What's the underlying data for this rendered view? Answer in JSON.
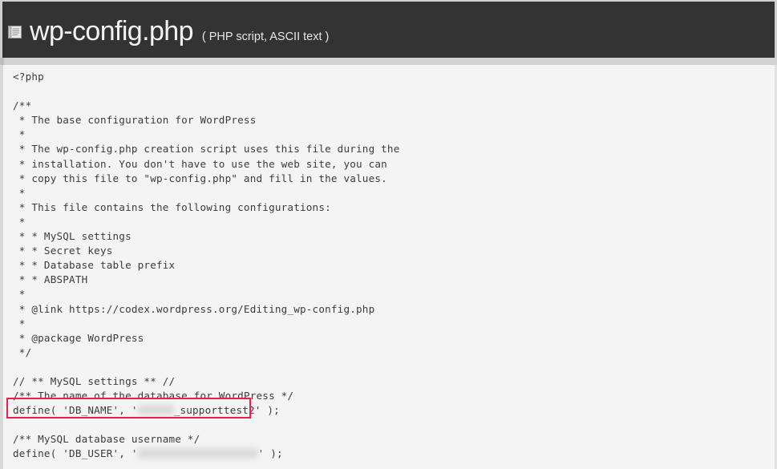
{
  "header": {
    "icon": "file-document-icon",
    "title": "wp-config.php",
    "meta": "( PHP script, ASCII text )"
  },
  "colors": {
    "header_bg": "#333333",
    "code_bg": "#f4f4f4",
    "code_text": "#3b3b3b",
    "highlight_border": "#e8204f",
    "title_text": "#f2f2f2"
  },
  "annotation": {
    "name": "db-name-highlight",
    "target_line": "define( 'DB_NAME', '[redacted]_supporttest2' );"
  },
  "code": {
    "language": "php",
    "lines": [
      "<?php",
      "",
      "/**",
      " * The base configuration for WordPress",
      " *",
      " * The wp-config.php creation script uses this file during the",
      " * installation. You don't have to use the web site, you can",
      " * copy this file to \"wp-config.php\" and fill in the values.",
      " *",
      " * This file contains the following configurations:",
      " *",
      " * * MySQL settings",
      " * * Secret keys",
      " * * Database table prefix",
      " * * ABSPATH",
      " *",
      " * @link https://codex.wordpress.org/Editing_wp-config.php",
      " *",
      " * @package WordPress",
      " */",
      "",
      "// ** MySQL settings ** //",
      "/** The name of the database for WordPress */",
      "DEFINE_DB_NAME_LINE",
      "",
      "/** MySQL database username */",
      "DEFINE_DB_USER_LINE"
    ],
    "db_name_line": {
      "prefix": "define( 'DB_NAME', '",
      "redacted": "[redacted]",
      "suffix": "_supporttest2' );"
    },
    "db_user_line": {
      "prefix": "define( 'DB_USER', '",
      "redacted": "[redacted]",
      "suffix": "' );"
    }
  }
}
